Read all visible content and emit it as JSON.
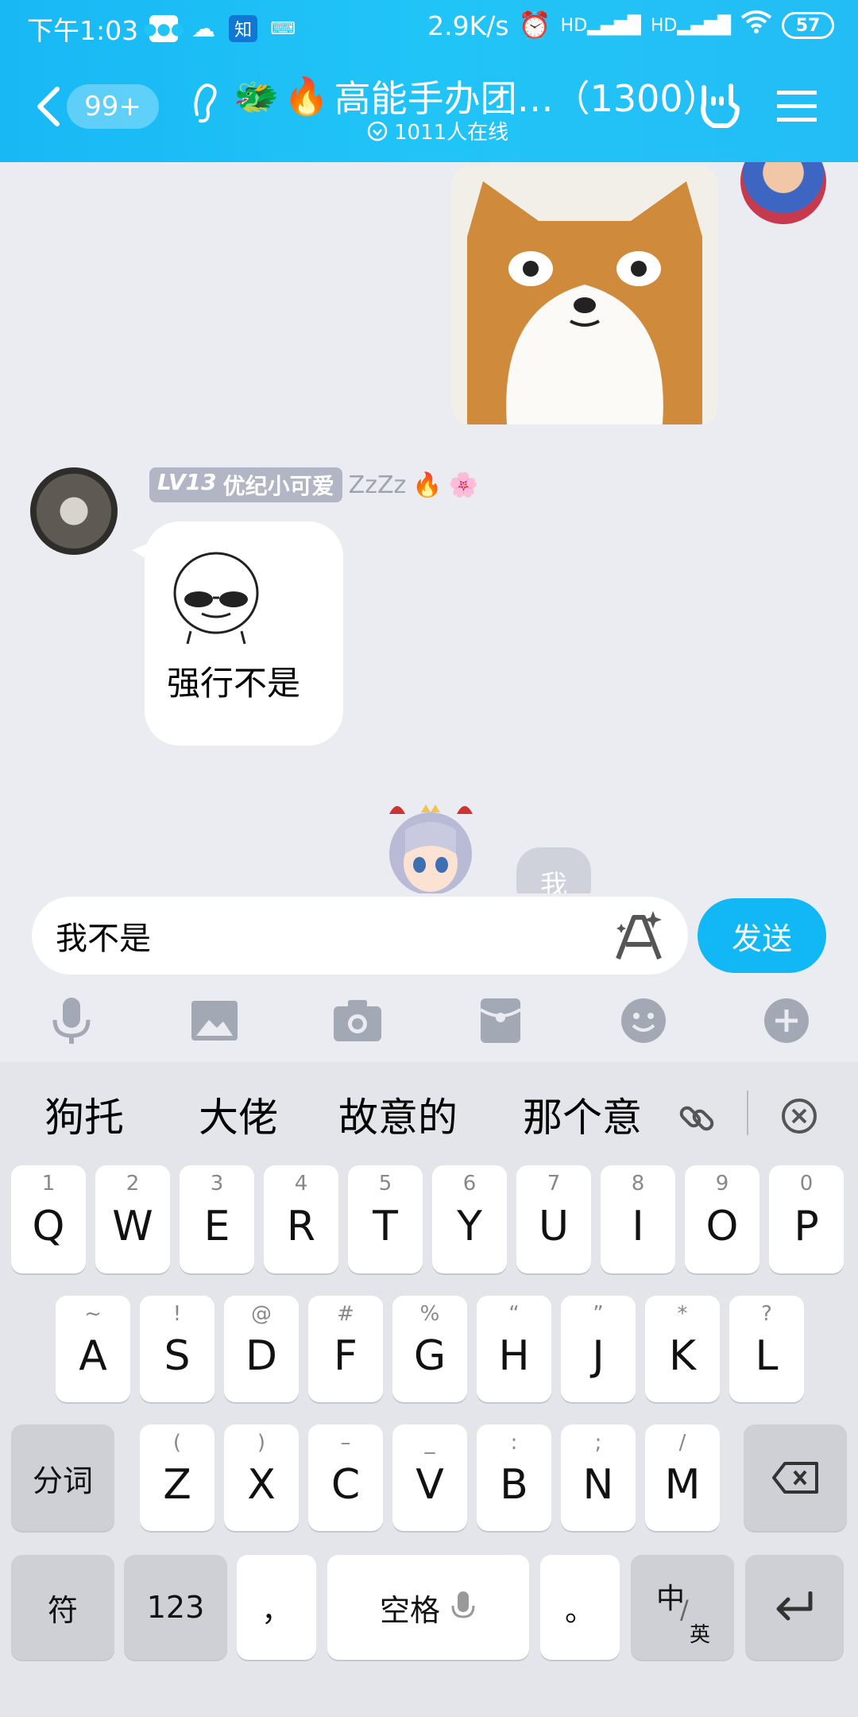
{
  "status_bar": {
    "time": "下午1:03",
    "zhi_label": "知",
    "speed": "2.9K/s",
    "hd1": "HD",
    "hd2": "HD",
    "battery": "57"
  },
  "header": {
    "back_badge": "99+",
    "title": "高能手办团…（1300）",
    "online": "1011人在线"
  },
  "messages": {
    "sender_level": "LV13",
    "sender_name": "优纪小可爱",
    "sender_status": "ZzZz",
    "sender_text": "强行不是",
    "mini_bubble": "我"
  },
  "input": {
    "value": "我不是",
    "send_label": "发送"
  },
  "keyboard": {
    "candidates": [
      "狗托",
      "大佬",
      "故意的",
      "那个意"
    ],
    "row1": [
      {
        "sub": "1",
        "k": "Q"
      },
      {
        "sub": "2",
        "k": "W"
      },
      {
        "sub": "3",
        "k": "E"
      },
      {
        "sub": "4",
        "k": "R"
      },
      {
        "sub": "5",
        "k": "T"
      },
      {
        "sub": "6",
        "k": "Y"
      },
      {
        "sub": "7",
        "k": "U"
      },
      {
        "sub": "8",
        "k": "I"
      },
      {
        "sub": "9",
        "k": "O"
      },
      {
        "sub": "0",
        "k": "P"
      }
    ],
    "row2": [
      {
        "sub": "~",
        "k": "A"
      },
      {
        "sub": "!",
        "k": "S"
      },
      {
        "sub": "@",
        "k": "D"
      },
      {
        "sub": "#",
        "k": "F"
      },
      {
        "sub": "%",
        "k": "G"
      },
      {
        "sub": "“",
        "k": "H"
      },
      {
        "sub": "”",
        "k": "J"
      },
      {
        "sub": "*",
        "k": "K"
      },
      {
        "sub": "?",
        "k": "L"
      }
    ],
    "row3": [
      {
        "sub": "(",
        "k": "Z"
      },
      {
        "sub": ")",
        "k": "X"
      },
      {
        "sub": "–",
        "k": "C"
      },
      {
        "sub": "_",
        "k": "V"
      },
      {
        "sub": ":",
        "k": "B"
      },
      {
        "sub": ";",
        "k": "N"
      },
      {
        "sub": "/",
        "k": "M"
      }
    ],
    "fenci": "分词",
    "fu": "符",
    "num": "123",
    "comma": "，",
    "space": "空格",
    "period": "。",
    "zh": "中",
    "en": "英"
  },
  "colors": {
    "header": "#21c4f7",
    "send": "#12b7f5",
    "chat_bg": "#ebecf1"
  }
}
